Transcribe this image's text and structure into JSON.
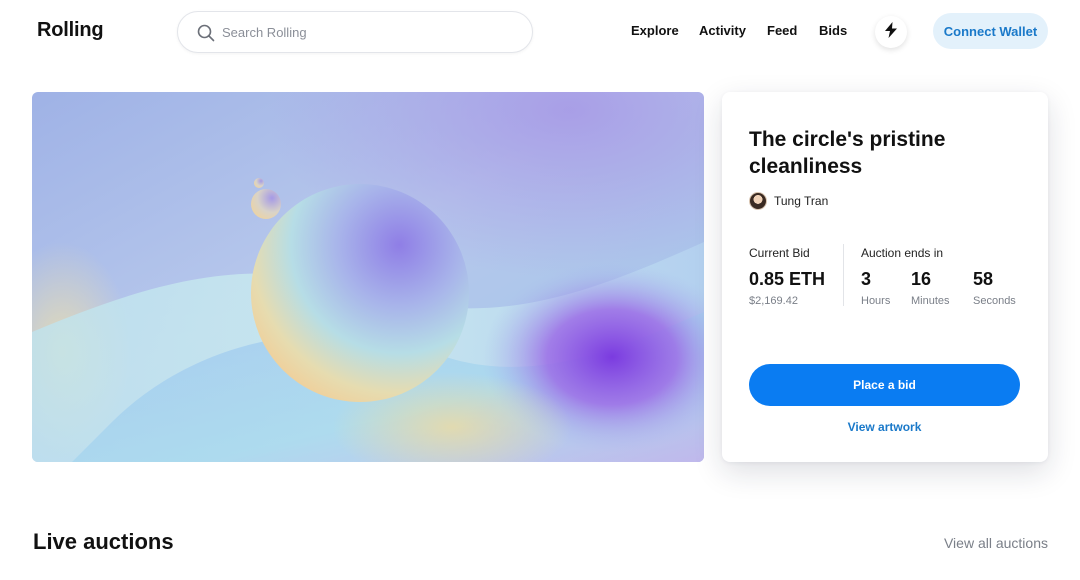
{
  "header": {
    "logo": "Rolling",
    "search": {
      "placeholder": "Search Rolling",
      "value": ""
    },
    "nav": [
      {
        "label": "Explore"
      },
      {
        "label": "Activity"
      },
      {
        "label": "Feed"
      },
      {
        "label": "Bids"
      }
    ],
    "bolt_icon": "lightning-bolt-icon",
    "connect_wallet_label": "Connect Wallet"
  },
  "featured": {
    "artwork_alt": "abstract gradient sphere artwork",
    "title": "The circle's pristine cleanliness",
    "creator": {
      "name": "Tung Tran"
    },
    "current_bid": {
      "label": "Current Bid",
      "value": "0.85 ETH",
      "usd": "$2,169.42"
    },
    "auction": {
      "label": "Auction ends in",
      "hours": "3",
      "hours_label": "Hours",
      "minutes": "16",
      "minutes_label": "Minutes",
      "seconds": "58",
      "seconds_label": "Seconds"
    },
    "place_bid_label": "Place a bid",
    "view_artwork_label": "View artwork"
  },
  "live_auctions": {
    "title": "Live auctions",
    "view_all_label": "View all auctions"
  },
  "colors": {
    "accent": "#0a7cf2",
    "link": "#1a79c9",
    "wallet_bg": "#e3f1fb",
    "muted": "#7a7f88"
  }
}
